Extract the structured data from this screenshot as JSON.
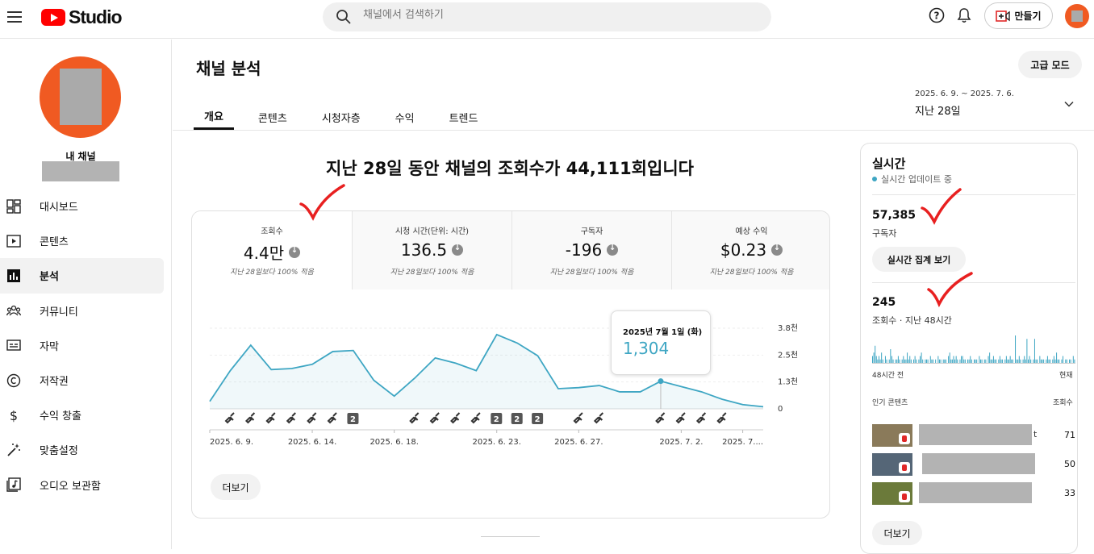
{
  "header": {
    "logo_text": "Studio",
    "search_placeholder": "채널에서 검색하기",
    "create_label": "만들기"
  },
  "sidebar": {
    "channel_name": "내 채널",
    "items": [
      {
        "label": "대시보드",
        "icon": "dashboard-icon"
      },
      {
        "label": "콘텐츠",
        "icon": "content-icon"
      },
      {
        "label": "분석",
        "icon": "analytics-icon",
        "active": true
      },
      {
        "label": "커뮤니티",
        "icon": "community-icon"
      },
      {
        "label": "자막",
        "icon": "subtitles-icon"
      },
      {
        "label": "저작권",
        "icon": "copyright-icon"
      },
      {
        "label": "수익 창출",
        "icon": "dollar-icon"
      },
      {
        "label": "맞춤설정",
        "icon": "magic-wand-icon"
      },
      {
        "label": "오디오 보관함",
        "icon": "audio-library-icon"
      }
    ]
  },
  "main": {
    "title": "채널 분석",
    "advanced_mode": "고급 모드",
    "date_range": "2025. 6. 9. ~ 2025. 7. 6.",
    "date_label": "지난 28일",
    "tabs": [
      "개요",
      "콘텐츠",
      "시청자층",
      "수익",
      "트렌드"
    ],
    "active_tab": 0,
    "headline": "지난 28일 동안 채널의 조회수가 44,111회입니다",
    "metrics": [
      {
        "label": "조회수",
        "value": "4.4만",
        "sub": "지난 28일보다 100% 적음"
      },
      {
        "label": "시청 시간(단위: 시간)",
        "value": "136.5",
        "sub": "지난 28일보다 100% 적음"
      },
      {
        "label": "구독자",
        "value": "-196",
        "sub": "지난 28일보다 100% 적음"
      },
      {
        "label": "예상 수익",
        "value": "$0.23",
        "sub": "지난 28일보다 100% 적음"
      }
    ],
    "tooltip": {
      "date": "2025년 7월 1일 (화)",
      "value": "1,304"
    },
    "more_label": "더보기"
  },
  "chart_data": {
    "type": "area",
    "x": [
      "2025. 6. 9.",
      "6. 10.",
      "6. 11.",
      "6. 12.",
      "6. 13.",
      "6. 14.",
      "6. 15.",
      "6. 16.",
      "6. 17.",
      "6. 18.",
      "6. 19.",
      "6. 20.",
      "6. 21.",
      "6. 22.",
      "6. 23.",
      "6. 24.",
      "6. 25.",
      "6. 26.",
      "6. 27.",
      "6. 28.",
      "6. 29.",
      "6. 30.",
      "7. 1.",
      "7. 2.",
      "7. 3.",
      "7. 4.",
      "7. 5.",
      "7. 6."
    ],
    "values": [
      350,
      1800,
      3000,
      1850,
      1900,
      2100,
      2700,
      2750,
      1350,
      600,
      1450,
      2400,
      2150,
      1800,
      3500,
      3100,
      2500,
      950,
      1000,
      1100,
      800,
      800,
      1304,
      1050,
      800,
      450,
      200,
      100
    ],
    "x_tick_labels": [
      "2025. 6. 9.",
      "2025. 6. 14.",
      "2025. 6. 18.",
      "2025. 6. 23.",
      "2025. 6. 27.",
      "2025. 7. 2.",
      "2025. 7...."
    ],
    "y_tick_labels": [
      "0",
      "1.3천",
      "2.5천",
      "3.8천"
    ],
    "ylim": [
      0,
      3800
    ],
    "markers": [
      "link",
      "link",
      "link",
      "link",
      "link",
      "link",
      "2",
      "",
      "",
      "link",
      "link",
      "link",
      "link",
      "2",
      "2",
      "2",
      "",
      "link",
      "link",
      "",
      "",
      "link",
      "link",
      "link",
      "link",
      "",
      "",
      ""
    ],
    "color": "#3ea6c3"
  },
  "realtime": {
    "title": "실시간",
    "live_label": "실시간 업데이트 중",
    "subscribers": "57,385",
    "subscribers_label": "구독자",
    "view_button": "실시간 집계 보기",
    "views": "245",
    "views_label": "조회수 · 지난 48시간",
    "axis_left": "48시간 전",
    "axis_right": "현재",
    "bars": [
      2,
      3,
      5,
      2,
      1,
      2,
      1,
      3,
      1,
      0,
      2,
      1,
      0,
      1,
      4,
      2,
      1,
      0,
      1,
      1,
      2,
      1,
      0,
      1,
      2,
      1,
      1,
      3,
      1,
      2,
      1,
      0,
      1,
      2,
      1,
      0,
      1,
      2,
      3,
      1,
      0,
      1,
      1,
      1,
      0,
      2,
      1,
      1,
      0,
      1,
      0,
      2,
      1,
      1,
      0,
      1,
      1,
      1,
      0,
      2,
      3,
      1,
      1,
      2,
      1,
      2,
      1,
      0,
      1,
      2,
      2,
      1,
      1,
      0,
      1,
      1,
      2,
      1,
      0,
      1,
      1,
      1,
      0,
      2,
      1,
      1,
      0,
      1,
      1,
      0,
      2,
      3,
      1,
      1,
      2,
      1,
      1,
      0,
      1,
      2,
      1,
      1,
      0,
      1,
      2,
      1,
      1,
      2,
      1,
      1,
      0,
      8,
      1,
      1,
      2,
      1,
      0,
      1,
      2,
      1,
      7,
      1,
      2,
      1,
      0,
      1,
      7,
      1,
      1,
      0,
      2,
      1,
      1,
      1,
      0,
      1,
      2,
      1,
      1,
      0,
      1,
      2,
      1,
      3,
      1,
      1,
      0,
      1,
      2,
      0,
      1,
      1,
      0,
      1,
      1,
      0,
      2,
      1
    ],
    "popular_label": "인기 콘텐츠",
    "popular_count_label": "조회수",
    "popular": [
      {
        "count": "71",
        "thumb": "#8a7a5a",
        "title_tail": "t"
      },
      {
        "count": "50",
        "thumb": "#556677",
        "title_tail": ""
      },
      {
        "count": "33",
        "thumb": "#6b7a3a",
        "title_tail": ""
      }
    ],
    "more_label": "더보기"
  }
}
